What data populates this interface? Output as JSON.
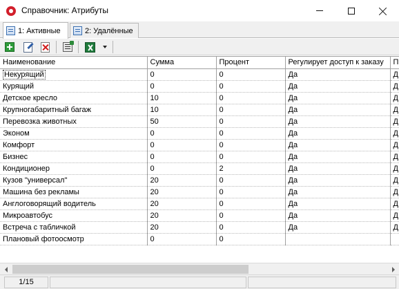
{
  "window": {
    "title": "Справочник: Атрибуты"
  },
  "tabs": [
    {
      "label": "1: Активные",
      "active": true
    },
    {
      "label": "2: Удалённые",
      "active": false
    }
  ],
  "toolbar": {
    "icons": [
      "add-icon",
      "edit-icon",
      "delete-icon",
      "properties-icon",
      "excel-export-icon",
      "dropdown-arrow-icon"
    ]
  },
  "grid": {
    "columns": [
      "Наименование",
      "Сумма",
      "Процент",
      "Регулирует доступ к заказу",
      "П"
    ],
    "rows": [
      [
        "Некурящий",
        "0",
        "0",
        "Да",
        "Д"
      ],
      [
        "Курящий",
        "0",
        "0",
        "Да",
        "Д"
      ],
      [
        "Детское кресло",
        "10",
        "0",
        "Да",
        "Д"
      ],
      [
        "Крупногабаритный багаж",
        "10",
        "0",
        "Да",
        "Д"
      ],
      [
        "Перевозка животных",
        "50",
        "0",
        "Да",
        "Д"
      ],
      [
        "Эконом",
        "0",
        "0",
        "Да",
        "Д"
      ],
      [
        "Комфорт",
        "0",
        "0",
        "Да",
        "Д"
      ],
      [
        "Бизнес",
        "0",
        "0",
        "Да",
        "Д"
      ],
      [
        "Кондиционер",
        "0",
        "2",
        "Да",
        "Д"
      ],
      [
        "Кузов \"универсал\"",
        "20",
        "0",
        "Да",
        "Д"
      ],
      [
        "Машина без рекламы",
        "20",
        "0",
        "Да",
        "Д"
      ],
      [
        "Англоговорящий водитель",
        "20",
        "0",
        "Да",
        "Д"
      ],
      [
        "Микроавтобус",
        "20",
        "0",
        "Да",
        "Д"
      ],
      [
        "Встреча с табличкой",
        "20",
        "0",
        "Да",
        "Д"
      ],
      [
        "Плановый фотоосмотр",
        "0",
        "0",
        "",
        ""
      ]
    ]
  },
  "status": {
    "record_position": "1/15"
  }
}
